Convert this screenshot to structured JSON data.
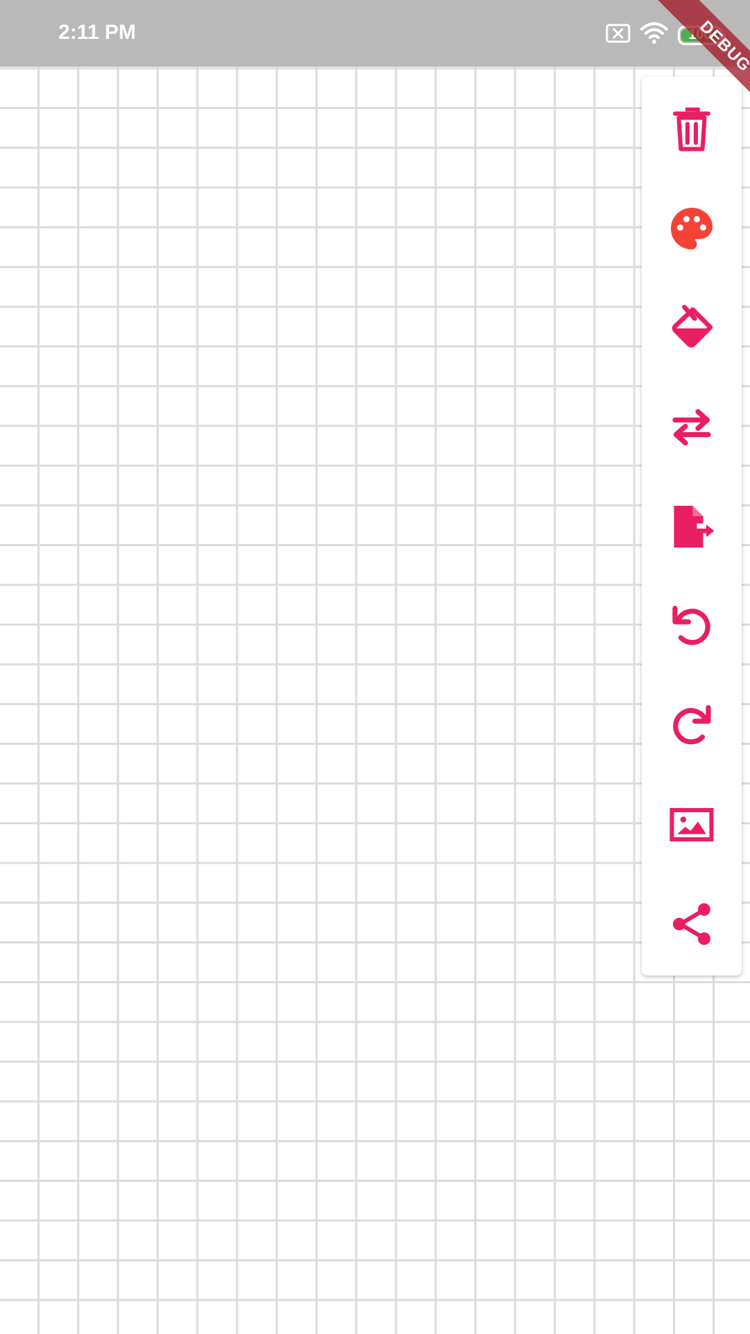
{
  "status_bar": {
    "time": "2:11 PM",
    "battery": "100",
    "icons": [
      "sim-off-icon",
      "wifi-icon",
      "battery-icon"
    ]
  },
  "debug_banner": {
    "label": "DEBUG"
  },
  "colors": {
    "accent": "#e91e63",
    "palette": "#f44336",
    "grid": "#dcdcdc",
    "status_bar": "#b9b9b9",
    "debug": "#a51426"
  },
  "toolbar": {
    "items": [
      {
        "icon": "trash-icon",
        "action": "delete"
      },
      {
        "icon": "palette-icon",
        "action": "color"
      },
      {
        "icon": "fill-icon",
        "action": "fill"
      },
      {
        "icon": "swap-icon",
        "action": "swap"
      },
      {
        "icon": "export-icon",
        "action": "export"
      },
      {
        "icon": "undo-icon",
        "action": "undo"
      },
      {
        "icon": "redo-icon",
        "action": "redo"
      },
      {
        "icon": "image-icon",
        "action": "image"
      },
      {
        "icon": "share-icon",
        "action": "share"
      }
    ]
  }
}
